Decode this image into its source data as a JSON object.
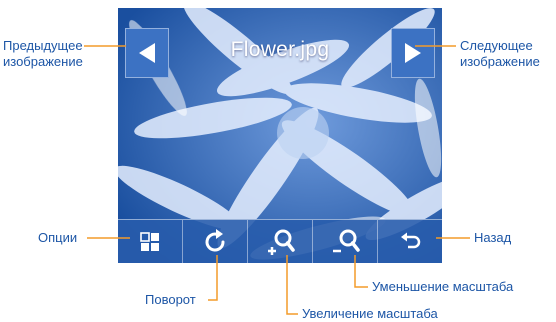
{
  "screen": {
    "title": "Flower.jpg",
    "prev_icon": "triangle-left-icon",
    "next_icon": "triangle-right-icon",
    "toolbar": [
      {
        "id": "options",
        "icon": "grid-icon"
      },
      {
        "id": "rotate",
        "icon": "rotate-icon"
      },
      {
        "id": "zoom-in",
        "icon": "zoom-in-icon"
      },
      {
        "id": "zoom-out",
        "icon": "zoom-out-icon"
      },
      {
        "id": "back",
        "icon": "back-arrow-icon"
      }
    ]
  },
  "callouts": {
    "prev_line1": "Предыдущее",
    "prev_line2": "изображение",
    "next_line1": "Следующее",
    "next_line2": "изображение",
    "options": "Опции",
    "back": "Назад",
    "zoom_out": "Уменьшение масштаба",
    "rotate": "Поворот",
    "zoom_in": "Увеличение масштаба"
  },
  "colors": {
    "screen_bg": "#1e56a8",
    "callout_text": "#1d56a6",
    "toolbar_bg": "#285cac"
  }
}
